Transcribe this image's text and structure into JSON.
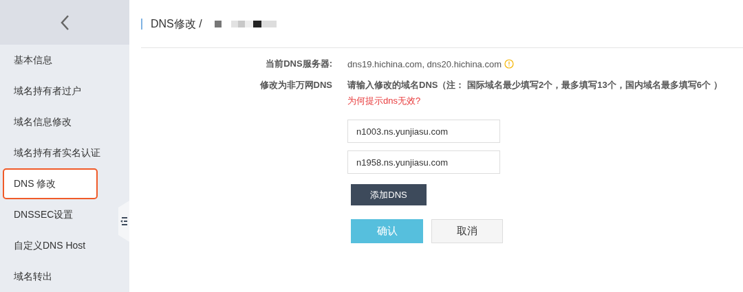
{
  "sidebar": {
    "items": [
      {
        "label": "基本信息",
        "selected": false,
        "highlighted": false
      },
      {
        "label": "域名持有者过户",
        "selected": false,
        "highlighted": false
      },
      {
        "label": "域名信息修改",
        "selected": false,
        "highlighted": false
      },
      {
        "label": "域名持有者实名认证",
        "selected": false,
        "highlighted": false
      },
      {
        "label": "DNS 修改",
        "selected": true,
        "highlighted": true
      },
      {
        "label": "DNSSEC设置",
        "selected": false,
        "highlighted": false
      },
      {
        "label": "自定义DNS Host",
        "selected": false,
        "highlighted": false
      },
      {
        "label": "域名转出",
        "selected": false,
        "highlighted": false
      }
    ]
  },
  "page_title": "DNS修改 /",
  "current_dns": {
    "label": "当前DNS服务器:",
    "value": "dns19.hichina.com, dns20.hichina.com"
  },
  "change_dns": {
    "label": "修改为非万网DNS",
    "instruction": "请输入修改的域名DNS（注： 国际域名最少填写2个，最多填写13个，国内域名最多填写6个 ）",
    "help_link": "为何提示dns无效?",
    "fields": [
      {
        "value": "n1003.ns.yunjiasu.com"
      },
      {
        "value": "n1958.ns.yunjiasu.com"
      }
    ],
    "add_button": "添加DNS",
    "confirm_button": "确认",
    "cancel_button": "取消"
  }
}
